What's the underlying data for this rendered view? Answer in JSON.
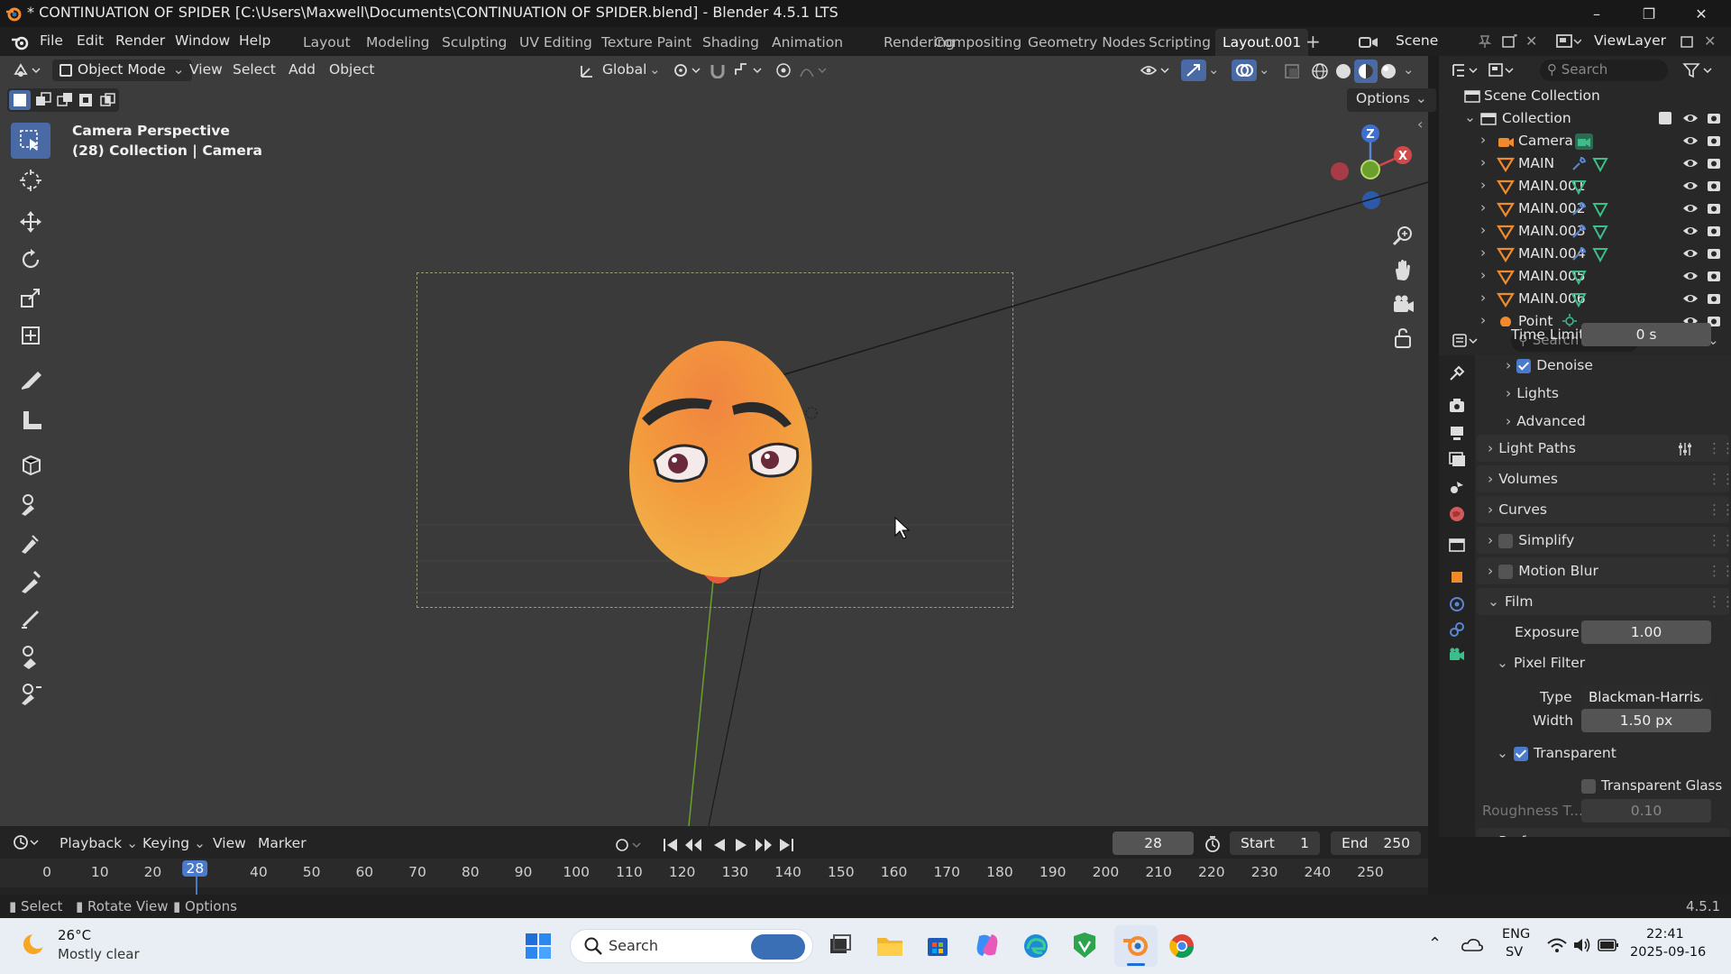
{
  "window": {
    "title": "* CONTINUATION OF SPIDER [C:\\Users\\Maxwell\\Documents\\CONTINUATION OF SPIDER.blend] - Blender 4.5.1 LTS"
  },
  "menu": {
    "file": "File",
    "edit": "Edit",
    "render": "Render",
    "window": "Window",
    "help": "Help"
  },
  "workspaces": [
    "Layout",
    "Modeling",
    "Sculpting",
    "UV Editing",
    "Texture Paint",
    "Shading",
    "Animation",
    "Rendering",
    "Compositing",
    "Geometry Nodes",
    "Scripting",
    "Layout.001"
  ],
  "scene": {
    "name": "Scene",
    "view_layer": "ViewLayer"
  },
  "viewport": {
    "mode": "Object Mode",
    "menus": [
      "View",
      "Select",
      "Add",
      "Object"
    ],
    "transform_orientation": "Global",
    "options": "Options",
    "overlay_title": "Camera Perspective",
    "overlay_sub": "(28) Collection | Camera",
    "gizmo_z": "Z",
    "gizmo_x": "X"
  },
  "outliner": {
    "search_placeholder": "Search",
    "root": "Scene Collection",
    "collection": "Collection",
    "items": [
      "Camera",
      "MAIN",
      "MAIN.001",
      "MAIN.002",
      "MAIN.003",
      "MAIN.004",
      "MAIN.005",
      "MAIN.006",
      "Point"
    ]
  },
  "properties": {
    "search_placeholder": "Search",
    "time_limit_label": "Time Limit",
    "time_limit_value": "0 s",
    "denoise": "Denoise",
    "lights": "Lights",
    "advanced": "Advanced",
    "light_paths": "Light Paths",
    "volumes": "Volumes",
    "curves": "Curves",
    "simplify": "Simplify",
    "motion_blur": "Motion Blur",
    "film": "Film",
    "exposure_label": "Exposure",
    "exposure_value": "1.00",
    "pixel_filter": "Pixel Filter",
    "type_label": "Type",
    "type_value": "Blackman-Harris",
    "width_label": "Width",
    "width_value": "1.50 px",
    "transparent": "Transparent",
    "transparent_glass": "Transparent Glass",
    "roughness_label": "Roughness T...",
    "roughness_value": "0.10",
    "performance": "Performance"
  },
  "timeline": {
    "playback": "Playback",
    "keying": "Keying",
    "view": "View",
    "marker": "Marker",
    "current_frame": "28",
    "start_label": "Start",
    "start_value": "1",
    "end_label": "End",
    "end_value": "250",
    "ticks": [
      "0",
      "10",
      "20",
      "28",
      "40",
      "50",
      "60",
      "70",
      "80",
      "90",
      "100",
      "110",
      "120",
      "130",
      "140",
      "150",
      "160",
      "170",
      "180",
      "190",
      "200",
      "210",
      "220",
      "230",
      "240",
      "250"
    ]
  },
  "statusbar": {
    "select": "Select",
    "rotate": "Rotate View",
    "options": "Options",
    "version": "4.5.1"
  },
  "taskbar": {
    "temp": "26°C",
    "weather": "Mostly clear",
    "search": "Search",
    "lang1": "ENG",
    "lang2": "SV",
    "time": "22:41",
    "date": "2025-09-16"
  },
  "colors": {
    "accent": "#4a7ac9",
    "active_tool": "#4a6aa5",
    "head_top": "#f07a3a",
    "head_bottom": "#f4c14a"
  }
}
